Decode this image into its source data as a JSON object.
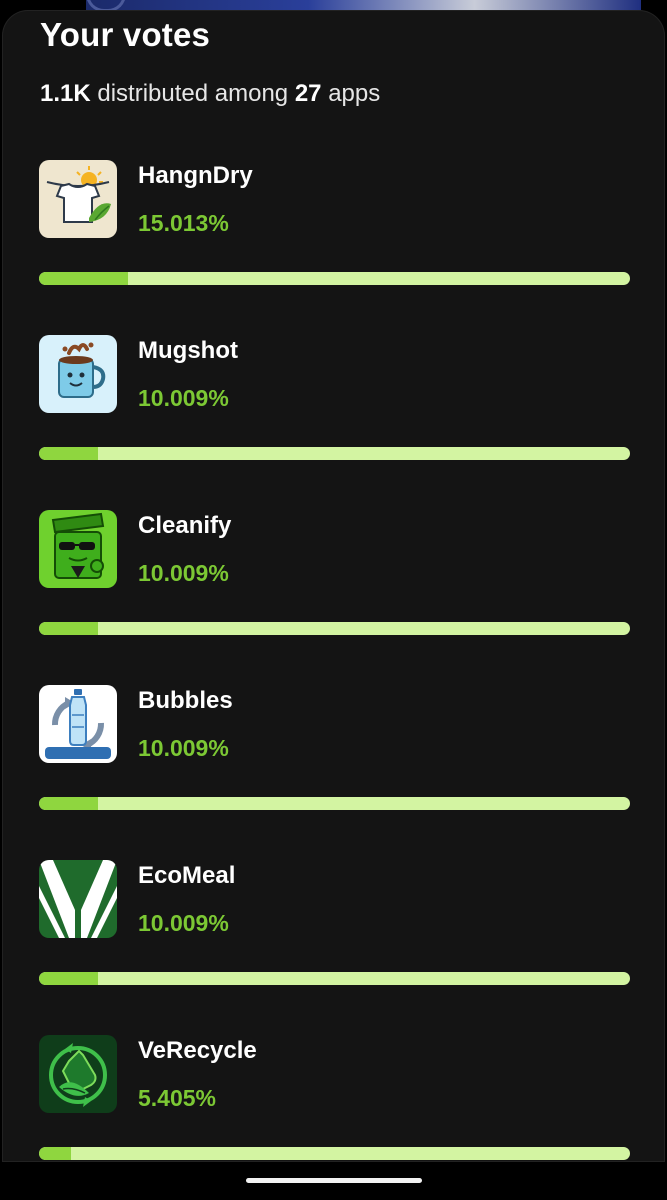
{
  "sheet": {
    "title": "Your votes",
    "summary": {
      "total": "1.1K",
      "middle_text": " distributed among ",
      "app_count": "27",
      "suffix": " apps"
    }
  },
  "apps": [
    {
      "name": "HangnDry",
      "percent_label": "15.013%",
      "share": 0.15013,
      "icon": "laundry-shirt-sun-icon"
    },
    {
      "name": "Mugshot",
      "percent_label": "10.009%",
      "share": 0.10009,
      "icon": "coffee-mug-icon"
    },
    {
      "name": "Cleanify",
      "percent_label": "10.009%",
      "share": 0.10009,
      "icon": "green-bin-character-icon"
    },
    {
      "name": "Bubbles",
      "percent_label": "10.009%",
      "share": 0.10009,
      "icon": "water-bottle-recycle-icon"
    },
    {
      "name": "EcoMeal",
      "percent_label": "10.009%",
      "share": 0.10009,
      "icon": "green-v-logo-icon"
    },
    {
      "name": "VeRecycle",
      "percent_label": "5.405%",
      "share": 0.05405,
      "icon": "recycle-bottle-leaf-icon"
    }
  ],
  "colors": {
    "sheet_background": "#141414",
    "percent_text": "#7cc834",
    "bar_track": "#d3f4a2",
    "bar_fill": "#8fd63f"
  }
}
